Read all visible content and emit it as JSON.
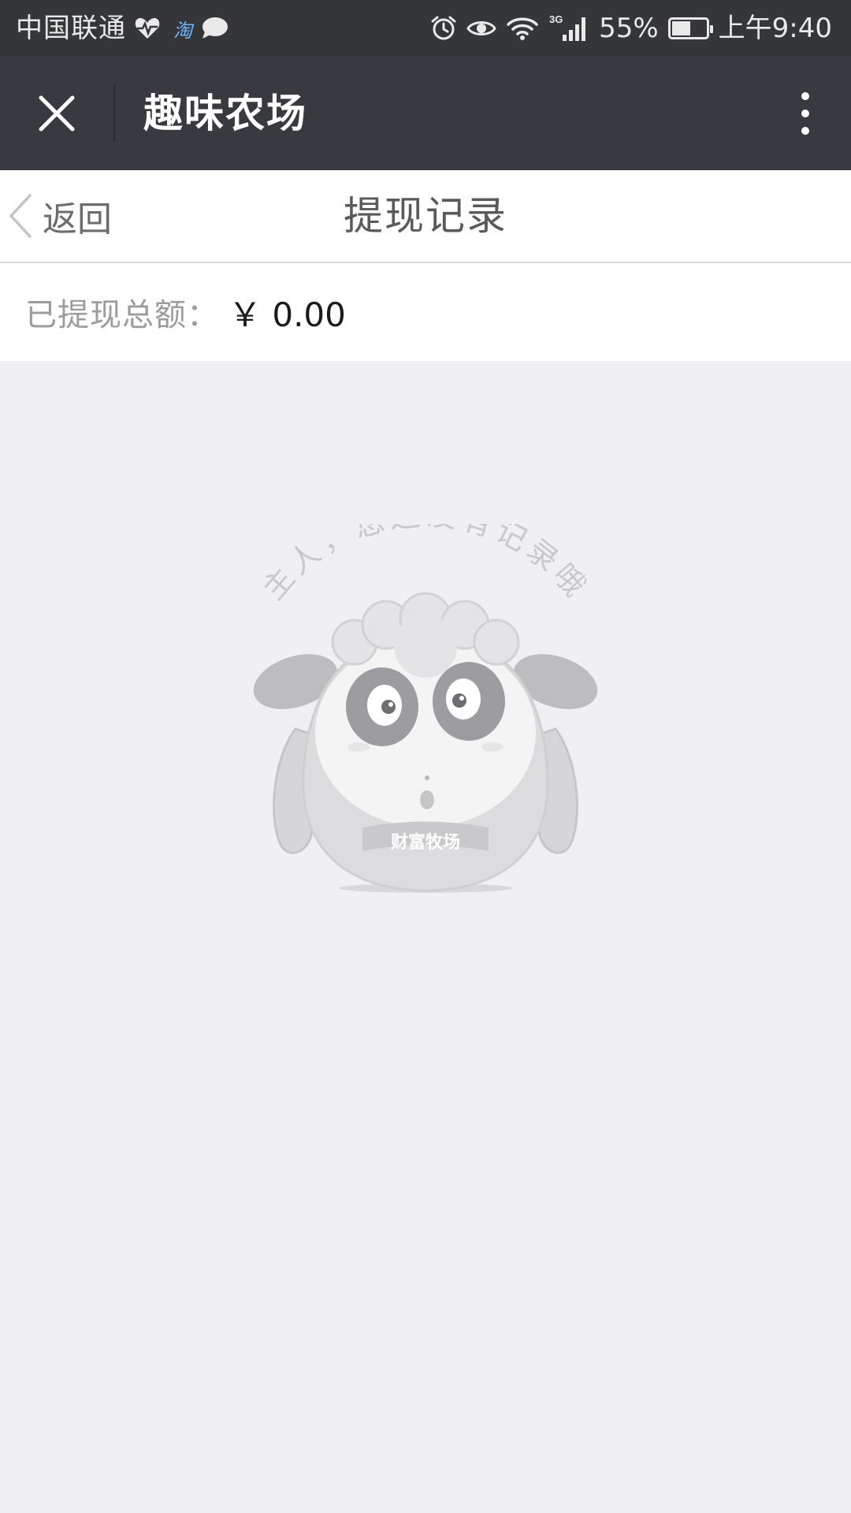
{
  "status_bar": {
    "carrier": "中国联通",
    "battery": "55%",
    "battery_level": 0.55,
    "time": "上午9:40",
    "network": "3G",
    "icons": [
      "heartbeat-icon",
      "taobao-icon",
      "chat-bubble-icon",
      "alarm-icon",
      "eye-icon",
      "wifi-icon",
      "signal-icon",
      "battery-icon"
    ]
  },
  "title_bar": {
    "title": "趣味农场",
    "close_icon": "close-icon",
    "more_icon": "more-vertical-icon"
  },
  "page_header": {
    "back_label": "返回",
    "title": "提现记录"
  },
  "summary": {
    "label": "已提现总额：",
    "amount": "￥ 0.00"
  },
  "empty_state": {
    "message": "主人，您还没有记录哦",
    "mascot_badge": "财富牧场"
  },
  "colors": {
    "status_bar_bg": "#35363a",
    "title_bar_bg": "#393a3f",
    "page_bg": "#efeff4",
    "header_bg": "#ffffff"
  }
}
